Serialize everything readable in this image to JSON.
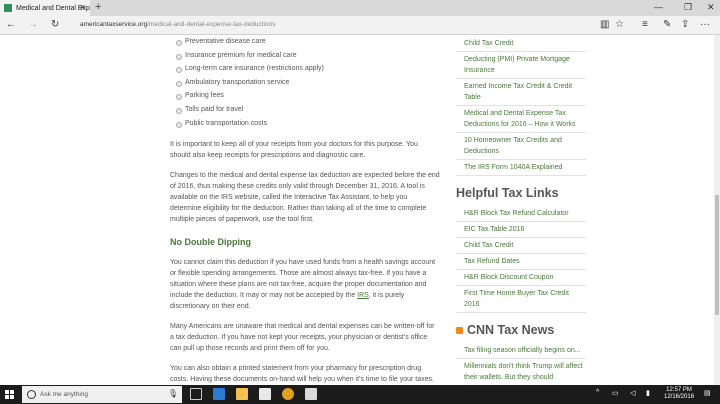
{
  "browser": {
    "tab_title": "Medical and Dental Exp",
    "url_domain": "americantaxservice.org",
    "url_path": "/medical-and-dental-expense-tax-deductions"
  },
  "main": {
    "bullets": [
      "Preventative disease care",
      "Insurance premium for medical care",
      "Long-term care insurance (restrictions apply)",
      "Ambulatory transportation service",
      "Parking fees",
      "Tolls paid for travel",
      "Public transportation costs"
    ],
    "p1": "It is important to keep all of your receipts from your doctors for this purpose. You should also keep receipts for prescriptions and diagnostic care.",
    "p2": "Changes to the medical and dental expense tax deduction are expected before the end of 2016, thus making these credits only valid through December 31, 2016. A tool is available on the IRS website, called the Interactive Tax Assistant, to help you determine eligibility for the deduction. Rather than taking all of the time to complete multiple pieces of paperwork, use the tool first.",
    "h_no_double": "No Double Dipping",
    "p3_a": "You cannot claim this deduction if you have used funds from a health savings account or flexible spending arrangements. Those are almost always tax-free. If you have a situation where these plans are not tax-free, acquire the proper documentation and include the deduction. It may or may not be accepted by the ",
    "p3_link": "IRS",
    "p3_b": ", it is purely discretionary on their end.",
    "p4": "Many Americans are unaware that medical and dental expenses can be written-off for a tax deduction. If you have not kept your receipts, your physician or dentist's office can pull up those records and print them off for you.",
    "p5": "You can also obtain a printed statement from your pharmacy for prescription drug costs. Having these documents on-hand will help you when it's time to file your taxes."
  },
  "sidebar": {
    "top_links": [
      "Child Tax Credit",
      "Deducting (PMI) Private Mortgage Insurance",
      "Earned Income Tax Credit & Credit Table",
      "Medical and Dental Expense Tax Deductions for 2016 – How it Works",
      "10 Homeowner Tax Credits and Deductions",
      "The IRS Form 1040A Explained"
    ],
    "helpful_title": "Helpful Tax Links",
    "helpful_links": [
      "H&R Block Tax Refund Calculator",
      "EIC Tax Table 2016",
      "Child Tax Credit",
      "Tax Refund Dates",
      "H&R Block Discount Coupon",
      "First Time Home Buyer Tax Credit 2016"
    ],
    "cnn_title": "CNN Tax News",
    "cnn_links": [
      "Tax filing season officially begins on...",
      "Millennials don't think Trump will affect their wallets. But they should"
    ]
  },
  "taskbar": {
    "search_placeholder": "Ask me anything",
    "time": "12:57 PM",
    "date": "12/16/2016"
  }
}
